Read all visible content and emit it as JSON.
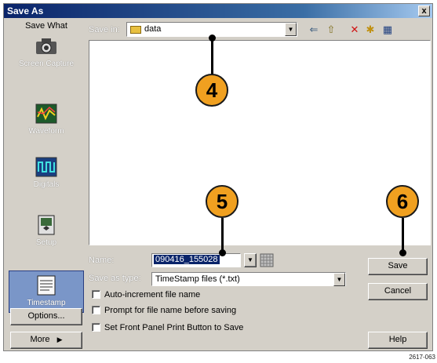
{
  "window": {
    "title": "Save As",
    "close_glyph": "x"
  },
  "left_panel": {
    "heading": "Save What",
    "items": [
      {
        "label": "Screen Capture",
        "icon": "camera-icon"
      },
      {
        "label": "Waveform",
        "icon": "waveform-icon"
      },
      {
        "label": "Digitals",
        "icon": "digitals-icon"
      },
      {
        "label": "Setup",
        "icon": "setup-icon"
      },
      {
        "label": "Timestamp",
        "icon": "timestamp-icon",
        "selected": true
      }
    ],
    "options_label": "Options...",
    "more_label": "More",
    "more_arrow": "▶"
  },
  "toolbar": {
    "save_in_label": "Save in:",
    "folder": "data",
    "back_glyph": "⇐",
    "up_glyph": "⇧",
    "delete_glyph": "✕",
    "new_folder_glyph": "✱",
    "view_glyph": "▦"
  },
  "form": {
    "name_label": "Name:",
    "name_value": "090416_155028",
    "type_label": "Save as type:",
    "type_value": "TimeStamp files (*.txt)",
    "checkboxes": [
      "Auto-increment file name",
      "Prompt for file name before saving",
      "Set Front Panel Print Button to Save"
    ]
  },
  "buttons": {
    "save": "Save",
    "cancel": "Cancel",
    "help": "Help"
  },
  "callouts": [
    "4",
    "5",
    "6"
  ],
  "figure_id": "2617-063",
  "colors": {
    "callout_fill": "#f0a020",
    "selection": "#0a246a",
    "title_bar": "#0a246a"
  }
}
